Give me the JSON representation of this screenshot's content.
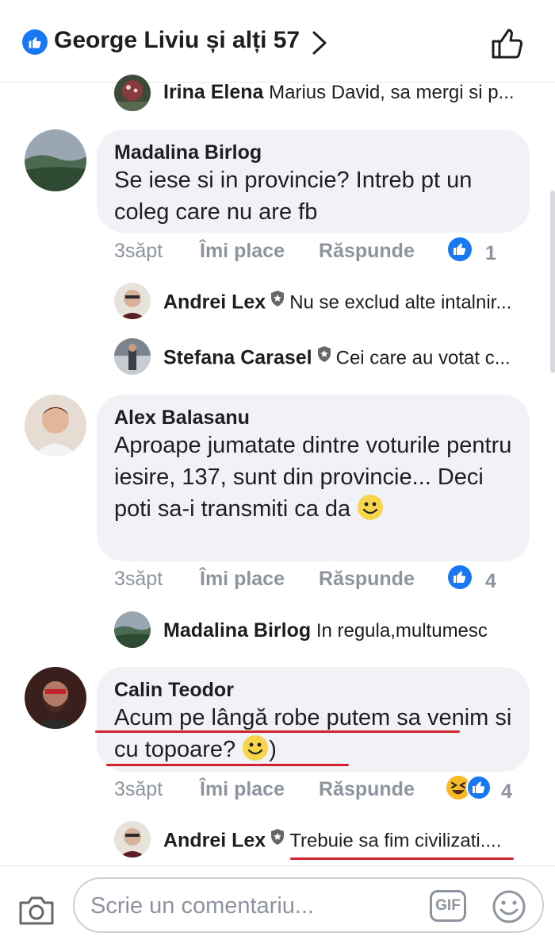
{
  "header": {
    "title": "George Liviu și alți 57"
  },
  "comments": [
    {
      "author": "Madalina Birlog",
      "text": "Se iese si in provincie? Intreb pt un coleg care nu are fb",
      "time": "3săpt",
      "like_label": "Îmi place",
      "reply_label": "Răspunde",
      "reaction_count": "1"
    },
    {
      "author": "Alex Balasanu",
      "text": "Aproape jumatate dintre voturile pentru iesire, 137, sunt din provincie... Deci poti sa-i transmiti ca da",
      "time": "3săpt",
      "like_label": "Îmi place",
      "reply_label": "Răspunde",
      "reaction_count": "4"
    },
    {
      "author": "Calin Teodor",
      "text": "Acum pe lângă robe putem sa venim si cu topoare?",
      "text_tail": ")",
      "time": "3săpt",
      "like_label": "Îmi place",
      "reply_label": "Răspunde",
      "reaction_count": "4"
    }
  ],
  "replies": [
    {
      "name": "Irina Elena",
      "text": "Marius David, sa mergi si p..."
    },
    {
      "name": "Andrei Lex",
      "text": "Nu se exclud alte intalnir..."
    },
    {
      "name": "Stefana Carasel",
      "text": "Cei care au votat c..."
    },
    {
      "name": "Madalina Birlog",
      "text": "In regula,multumesc"
    },
    {
      "name": "Andrei Lex",
      "text": "Trebuie sa fim civilizati...."
    }
  ],
  "composer": {
    "placeholder": "Scrie un comentariu...",
    "gif_label": "GIF"
  },
  "colors": {
    "accent": "#1877f2",
    "bubble": "#f0f2f5",
    "meta": "#8d949e",
    "underline": "#d3212d",
    "haha": "#f7b928"
  },
  "icons": [
    "like-icon",
    "chevron-right-icon",
    "thumbs-up-outline-icon",
    "camera-icon",
    "gif-icon",
    "smiley-icon",
    "haha-icon",
    "verified-badge-icon"
  ]
}
